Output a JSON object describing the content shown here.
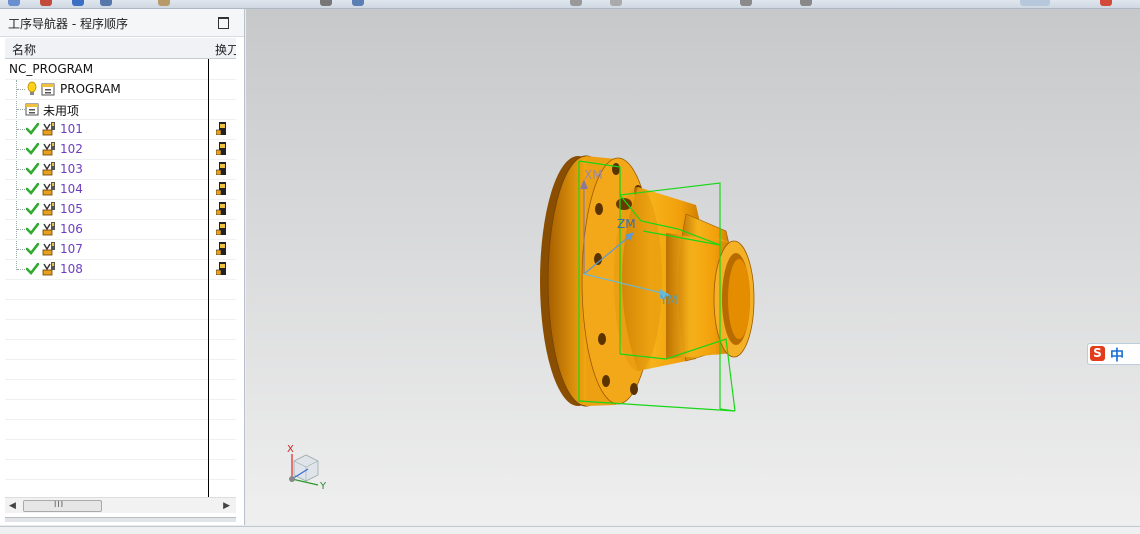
{
  "navigator": {
    "title": "工序导航器 - 程序顺序",
    "columns": {
      "name": "名称",
      "tool": "换刀"
    },
    "root": "NC_PROGRAM",
    "program": "PROGRAM",
    "unused": "未用项",
    "operations": [
      {
        "name": "101",
        "status": "complete"
      },
      {
        "name": "102",
        "status": "complete"
      },
      {
        "name": "103",
        "status": "complete"
      },
      {
        "name": "104",
        "status": "complete"
      },
      {
        "name": "105",
        "status": "complete"
      },
      {
        "name": "106",
        "status": "complete"
      },
      {
        "name": "107",
        "status": "complete"
      },
      {
        "name": "108",
        "status": "complete"
      }
    ],
    "scroll_grip": "III"
  },
  "viewport": {
    "csys_labels": {
      "xm": "XM",
      "ym": "YM",
      "zm": "ZM"
    },
    "triad_labels": {
      "x": "X",
      "y": "Y"
    },
    "part_color": "#f0a10a",
    "bbox_color": "#19d619"
  },
  "ime": {
    "logo": "S",
    "lang": "中"
  },
  "colors": {
    "op_text": "#6c3fbf",
    "check": "#2faa2f"
  }
}
